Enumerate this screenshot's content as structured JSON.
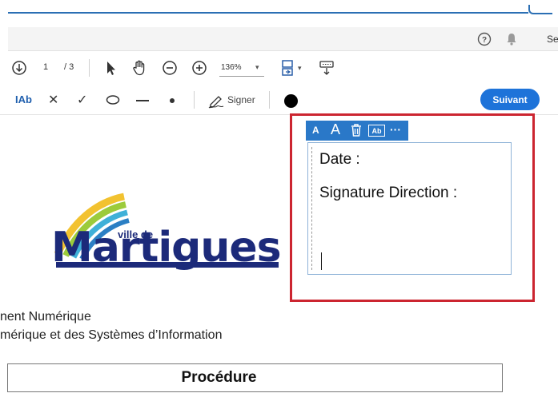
{
  "header": {
    "user_initials": "Se"
  },
  "toolbar_1": {
    "page_current": "1",
    "page_total": "/ 3",
    "zoom": "136%",
    "zoom_caret": "▾",
    "layout_caret": "▾"
  },
  "toolbar_2": {
    "text_tool_label": "IAb",
    "cross_label": "✕",
    "check_label": "✓",
    "signer_label": "Signer",
    "suivant_label": "Suivant",
    "color_dot": "#000000"
  },
  "mini_toolbar": {
    "font_small": "A",
    "font_large": "A",
    "field_label": "Ab",
    "more": "···"
  },
  "text_field": {
    "date_label": "Date :",
    "signature_label": "Signature Direction :"
  },
  "document": {
    "logo_small": "ville de",
    "logo_word": "Martigues",
    "dept_line_1": "nent Numérique",
    "dept_line_2": "mérique et des Systèmes d’Information",
    "procedure_title": "Procédure"
  },
  "colors": {
    "accent": "#1e73d9",
    "highlight": "#cc2530",
    "mini_toolbar": "#2a78c8",
    "logo_blue": "#1c2a7a"
  }
}
